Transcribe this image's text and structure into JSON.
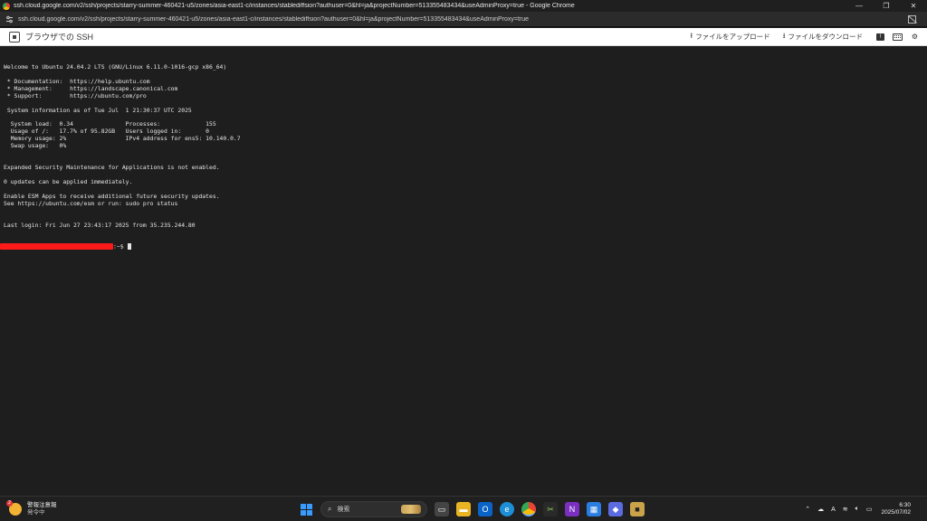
{
  "window": {
    "title": "ssh.cloud.google.com/v2/ssh/projects/starry-summer-460421-u5/zones/asia-east1-c/instances/stablediffsion?authuser=0&hl=ja&projectNumber=513355483434&useAdminProxy=true - Google Chrome",
    "url": "ssh.cloud.google.com/v2/ssh/projects/starry-summer-460421-u5/zones/asia-east1-c/instances/stablediffsion?authuser=0&hl=ja&projectNumber=513355483434&useAdminProxy=true"
  },
  "appbar": {
    "title": "ブラウザでの SSH",
    "upload_label": "ファイルをアップロード",
    "download_label": "ファイルをダウンロード"
  },
  "terminal": {
    "lines": [
      "Welcome to Ubuntu 24.04.2 LTS (GNU/Linux 6.11.0-1016-gcp x86_64)",
      "",
      " * Documentation:  https://help.ubuntu.com",
      " * Management:     https://landscape.canonical.com",
      " * Support:        https://ubuntu.com/pro",
      "",
      " System information as of Tue Jul  1 21:30:37 UTC 2025",
      "",
      "  System load:  0.34               Processes:             155",
      "  Usage of /:   17.7% of 95.82GB   Users logged in:       0",
      "  Memory usage: 2%                 IPv4 address for ens5: 10.140.0.7",
      "  Swap usage:   0%",
      "",
      "",
      "Expanded Security Maintenance for Applications is not enabled.",
      "",
      "0 updates can be applied immediately.",
      "",
      "Enable ESM Apps to receive additional future security updates.",
      "See https://ubuntu.com/esm or run: sudo pro status",
      "",
      "",
      "Last login: Fri Jun 27 23:43:17 2025 from 35.235.244.80"
    ],
    "prompt_suffix": ":~$ "
  },
  "taskbar": {
    "weather_title": "警報注意報",
    "weather_sub": "発令中",
    "search_placeholder": "検索",
    "time": "6:30",
    "date": "2025/07/02",
    "ime": "A"
  },
  "colors": {
    "terminal_bg": "#1e1e1e",
    "terminal_fg": "#e6e6e6",
    "redaction": "#ff1a1a"
  }
}
